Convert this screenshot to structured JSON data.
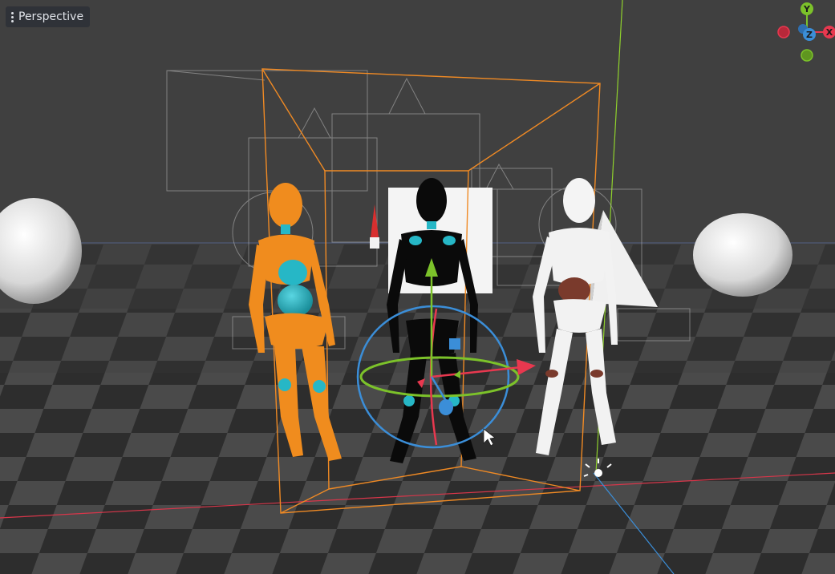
{
  "viewport": {
    "mode_label": "Perspective",
    "menu_icon": "kebab-menu-icon"
  },
  "axis_gizmo": {
    "y_label": "Y",
    "z_label": "Z",
    "x_label": "X",
    "colors": {
      "x": "#e8384f",
      "y": "#7cc22a",
      "z": "#3b8ed8"
    }
  },
  "scene": {
    "characters": [
      {
        "name": "orange-mannequin",
        "body": "#f08c1e",
        "joints": "#26b7c6"
      },
      {
        "name": "black-mannequin",
        "body": "#0a0a0a",
        "joints": "#26b7c6"
      },
      {
        "name": "white-mannequin",
        "body": "#f2f2f2",
        "joints": "#7a3a2c"
      }
    ],
    "selection_color": "#f08a24"
  }
}
